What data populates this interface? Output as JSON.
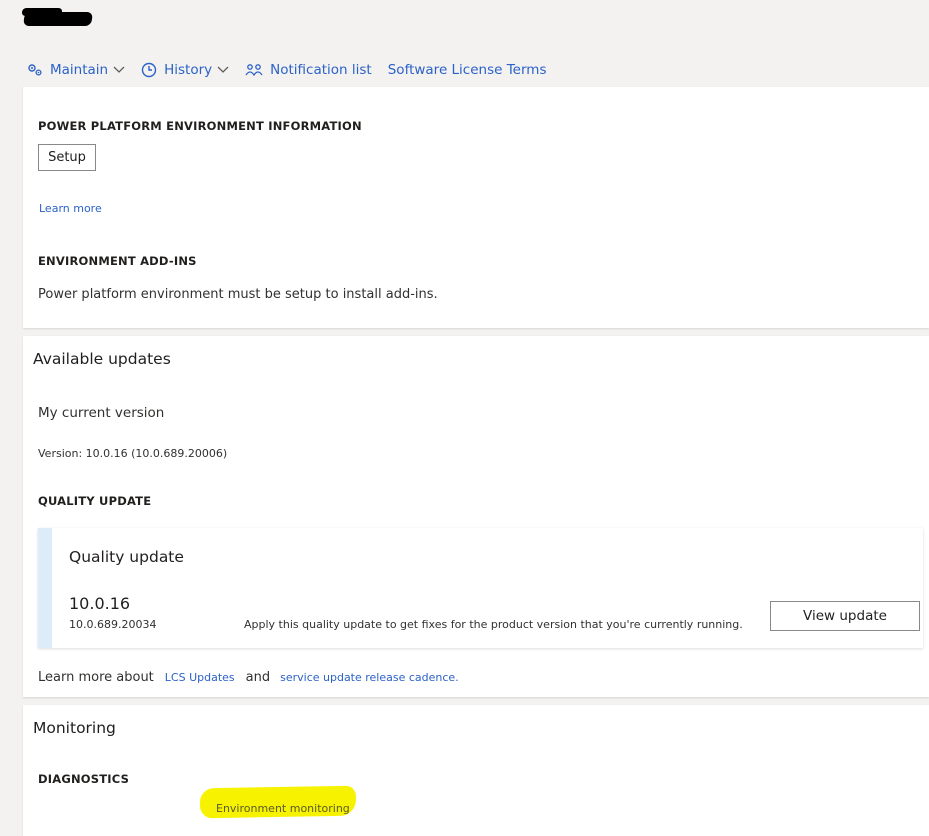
{
  "header": {
    "title_redacted": true
  },
  "commandbar": {
    "maintain": "Maintain",
    "history": "History",
    "notification_list": "Notification list",
    "software_license_terms": "Software License Terms"
  },
  "power_platform": {
    "heading": "POWER PLATFORM ENVIRONMENT INFORMATION",
    "setup_button": "Setup",
    "learn_more": "Learn more",
    "addins_heading": "ENVIRONMENT ADD-INS",
    "addins_message": "Power platform environment must be setup to install add-ins."
  },
  "updates": {
    "title": "Available updates",
    "current_version_label": "My current version",
    "version_text": "Version: 10.0.16 (10.0.689.20006)",
    "quality_heading": "QUALITY UPDATE",
    "quality_card": {
      "title": "Quality update",
      "version": "10.0.16",
      "build": "10.0.689.20034",
      "description": "Apply this quality update to get fixes for the product version that you're currently running.",
      "button": "View update"
    },
    "footer": {
      "prefix": "Learn more about",
      "lcs_link": "LCS Updates",
      "and": "and",
      "cadence_link": "service update release cadence."
    }
  },
  "monitoring": {
    "title": "Monitoring",
    "diagnostics_heading": "DIAGNOSTICS",
    "env_monitoring_link": "Environment monitoring"
  },
  "colors": {
    "link": "#2b62c8",
    "highlight": "#f7f300",
    "accent_bar": "#deecf9"
  }
}
